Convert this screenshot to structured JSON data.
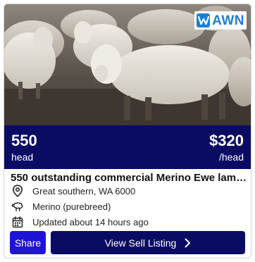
{
  "photo": {
    "alt": "Flock of Merino sheep",
    "logo_text": "AWN",
    "logo_color": "#1c7fd6"
  },
  "band": {
    "quantity": "550",
    "quantity_unit": "head",
    "price": "$320",
    "price_unit": "/head",
    "color": "#0a0c63"
  },
  "listing": {
    "title": "550 outstanding commercial Merino Ewe lambs",
    "location": "Great southern, WA 6000",
    "breed": "Merino (purebreed)",
    "updated": "Updated about 14 hours ago"
  },
  "actions": {
    "share_label": "Share",
    "share_color": "#1f14d4",
    "view_label": "View Sell Listing"
  },
  "icons": {
    "location": "map-pin-icon",
    "breed": "sheep-icon",
    "updated": "calendar-icon",
    "view": "chevron-right-icon"
  }
}
